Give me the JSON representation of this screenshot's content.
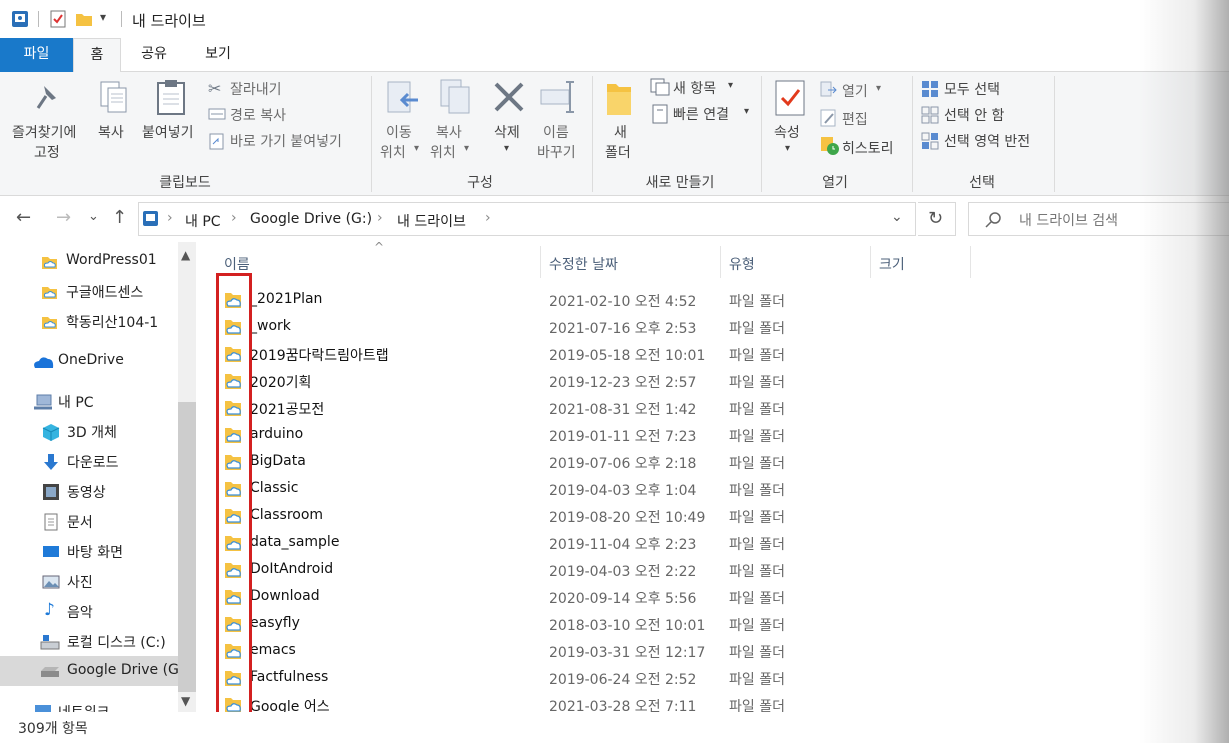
{
  "window": {
    "title": "내 드라이브"
  },
  "tabs": [
    "파일",
    "홈",
    "공유",
    "보기"
  ],
  "ribbon": {
    "clipboard": {
      "pin_line1": "즐겨찾기에",
      "pin_line2": "고정",
      "copy": "복사",
      "paste": "붙여넣기",
      "cut": "잘라내기",
      "copy_path": "경로 복사",
      "paste_shortcut": "바로 가기 붙여넣기",
      "label": "클립보드"
    },
    "organize": {
      "move_line1": "이동",
      "move_line2": "위치",
      "copy_line1": "복사",
      "copy_line2": "위치",
      "delete": "삭제",
      "rename_line1": "이름",
      "rename_line2": "바꾸기",
      "label": "구성"
    },
    "new": {
      "folder_line1": "새",
      "folder_line2": "폴더",
      "new_item": "새 항목",
      "easy_access": "빠른 연결",
      "label": "새로 만들기"
    },
    "open": {
      "properties": "속성",
      "open": "열기",
      "edit": "편집",
      "history": "히스토리",
      "label": "열기"
    },
    "select": {
      "select_all": "모두 선택",
      "select_none": "선택 안 함",
      "invert": "선택 영역 반전",
      "label": "선택"
    }
  },
  "address": {
    "crumbs": [
      "내 PC",
      "Google Drive (G:)",
      "내 드라이브"
    ],
    "search_placeholder": "내 드라이브 검색"
  },
  "nav": {
    "items": [
      {
        "label": "WordPress01",
        "icon": "cloud-folder-icon"
      },
      {
        "label": "구글애드센스",
        "icon": "cloud-folder-icon"
      },
      {
        "label": "학동리산104-1",
        "icon": "cloud-folder-icon"
      },
      {
        "label": "OneDrive",
        "icon": "onedrive-icon"
      },
      {
        "label": "내 PC",
        "icon": "pc-icon"
      },
      {
        "label": "3D 개체",
        "icon": "3d-objects-icon"
      },
      {
        "label": "다운로드",
        "icon": "download-icon"
      },
      {
        "label": "동영상",
        "icon": "video-icon"
      },
      {
        "label": "문서",
        "icon": "document-icon"
      },
      {
        "label": "바탕 화면",
        "icon": "desktop-icon"
      },
      {
        "label": "사진",
        "icon": "picture-icon"
      },
      {
        "label": "음악",
        "icon": "music-icon"
      },
      {
        "label": "로컬 디스크 (C:)",
        "icon": "drive-icon"
      },
      {
        "label": "Google Drive (G",
        "icon": "google-drive-icon"
      },
      {
        "label": "네트워크",
        "icon": "network-icon"
      }
    ]
  },
  "columns": {
    "name": "이름",
    "modified": "수정한 날짜",
    "type": "유형",
    "size": "크기"
  },
  "files": [
    {
      "name": "_2021Plan",
      "modified": "2021-02-10 오전 4:52",
      "type": "파일 폴더"
    },
    {
      "name": "_work",
      "modified": "2021-07-16 오후 2:53",
      "type": "파일 폴더"
    },
    {
      "name": "2019꿈다락드림아트랩",
      "modified": "2019-05-18 오전 10:01",
      "type": "파일 폴더"
    },
    {
      "name": "2020기획",
      "modified": "2019-12-23 오전 2:57",
      "type": "파일 폴더"
    },
    {
      "name": "2021공모전",
      "modified": "2021-08-31 오전 1:42",
      "type": "파일 폴더"
    },
    {
      "name": "arduino",
      "modified": "2019-01-11 오전 7:23",
      "type": "파일 폴더"
    },
    {
      "name": "BigData",
      "modified": "2019-07-06 오후 2:18",
      "type": "파일 폴더"
    },
    {
      "name": "Classic",
      "modified": "2019-04-03 오후 1:04",
      "type": "파일 폴더"
    },
    {
      "name": "Classroom",
      "modified": "2019-08-20 오전 10:49",
      "type": "파일 폴더"
    },
    {
      "name": "data_sample",
      "modified": "2019-11-04 오후 2:23",
      "type": "파일 폴더"
    },
    {
      "name": "DoItAndroid",
      "modified": "2019-04-03 오전 2:22",
      "type": "파일 폴더"
    },
    {
      "name": "Download",
      "modified": "2020-09-14 오후 5:56",
      "type": "파일 폴더"
    },
    {
      "name": "easyfly",
      "modified": "2018-03-10 오전 10:01",
      "type": "파일 폴더"
    },
    {
      "name": "emacs",
      "modified": "2019-03-31 오전 12:17",
      "type": "파일 폴더"
    },
    {
      "name": "Factfulness",
      "modified": "2019-06-24 오전 2:52",
      "type": "파일 폴더"
    },
    {
      "name": "Google 어스",
      "modified": "2021-03-28 오전 7:11",
      "type": "파일 폴더"
    }
  ],
  "status": {
    "count": "309개 항목"
  },
  "colors": {
    "file_tab": "#1979ca",
    "highlight": "#d32020",
    "folder": "#f5c242",
    "cloud": "#3a8fd8"
  }
}
